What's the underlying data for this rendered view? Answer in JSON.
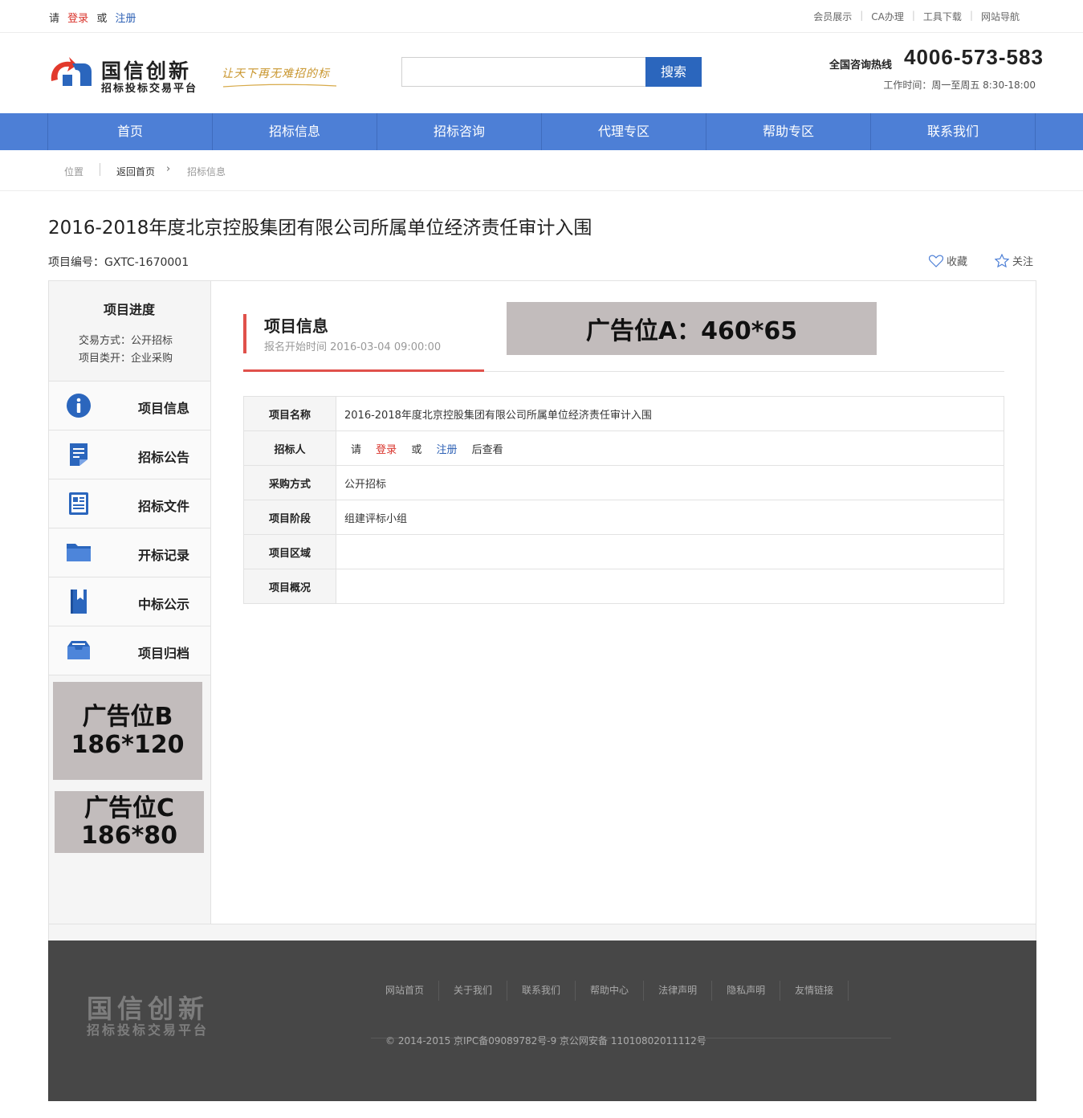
{
  "topbar": {
    "login_hint": {
      "please": "请",
      "login": "登录",
      "or": "或",
      "register": "注册"
    },
    "links": [
      "会员展示",
      "CA办理",
      "工具下载",
      "网站导航"
    ]
  },
  "header": {
    "logo_name": "国信创新",
    "logo_sub": "招标投标交易平台",
    "slogan": "让天下再无难招的标",
    "search_placeholder": "",
    "search_button": "搜索",
    "hotline_label": "全国咨询热线",
    "hotline_number": "4006-573-583",
    "worktime": "工作时间：周一至周五 8:30-18:00"
  },
  "nav": [
    "首页",
    "招标信息",
    "招标咨询",
    "代理专区",
    "帮助专区",
    "联系我们"
  ],
  "breadcrumb": {
    "position": "位置",
    "home": "返回首页",
    "arrow": "›",
    "current": "招标信息"
  },
  "project": {
    "title": "2016-2018年度北京控股集团有限公司所属单位经济责任审计入围",
    "number": "项目编号：GXTC-1670001",
    "favorite": "收藏",
    "follow": "关注"
  },
  "sidebar": {
    "progress_title": "项目进度",
    "trade_mode": "交易方式：公开招标",
    "category": "项目类开：企业采购",
    "menu": [
      {
        "label": "项目信息",
        "icon": "info-icon"
      },
      {
        "label": "招标公告",
        "icon": "document-icon"
      },
      {
        "label": "招标文件",
        "icon": "file-icon"
      },
      {
        "label": "开标记录",
        "icon": "folder-icon"
      },
      {
        "label": "中标公示",
        "icon": "bookmark-icon"
      },
      {
        "label": "项目归档",
        "icon": "archive-icon"
      }
    ],
    "ad_b": {
      "line1": "广告位B",
      "line2": "186*120"
    },
    "ad_c": {
      "line1": "广告位C",
      "line2": "186*80"
    }
  },
  "content": {
    "section_title": "项目信息",
    "signup_time": "报名开始时间 2016-03-04 09:00:00",
    "ad_a": "广告位A：460*65",
    "rows": [
      {
        "key": "项目名称",
        "value": "2016-2018年度北京控股集团有限公司所属单位经济责任审计入围"
      },
      {
        "key": "招标人",
        "value": ""
      },
      {
        "key": "采购方式",
        "value": "公开招标"
      },
      {
        "key": "项目阶段",
        "value": "组建评标小组"
      },
      {
        "key": "项目区域",
        "value": ""
      },
      {
        "key": "项目概况",
        "value": ""
      }
    ],
    "bidder_hint": {
      "please": "请",
      "login": "登录",
      "or": "或",
      "register": "注册",
      "after": "后查看"
    }
  },
  "footer": {
    "logo_name": "国信创新",
    "logo_sub": "招标投标交易平台",
    "links": [
      "网站首页",
      "关于我们",
      "联系我们",
      "帮助中心",
      "法律声明",
      "隐私声明",
      "友情链接"
    ],
    "copyright": "© 2014-2015 京IPC备09089782号-9 京公网安备 11010802011112号"
  },
  "colors": {
    "nav_bg": "#4d7fd6",
    "accent_red": "#e0514b",
    "link_blue": "#2b5fb4",
    "footer_bg": "#474747"
  }
}
